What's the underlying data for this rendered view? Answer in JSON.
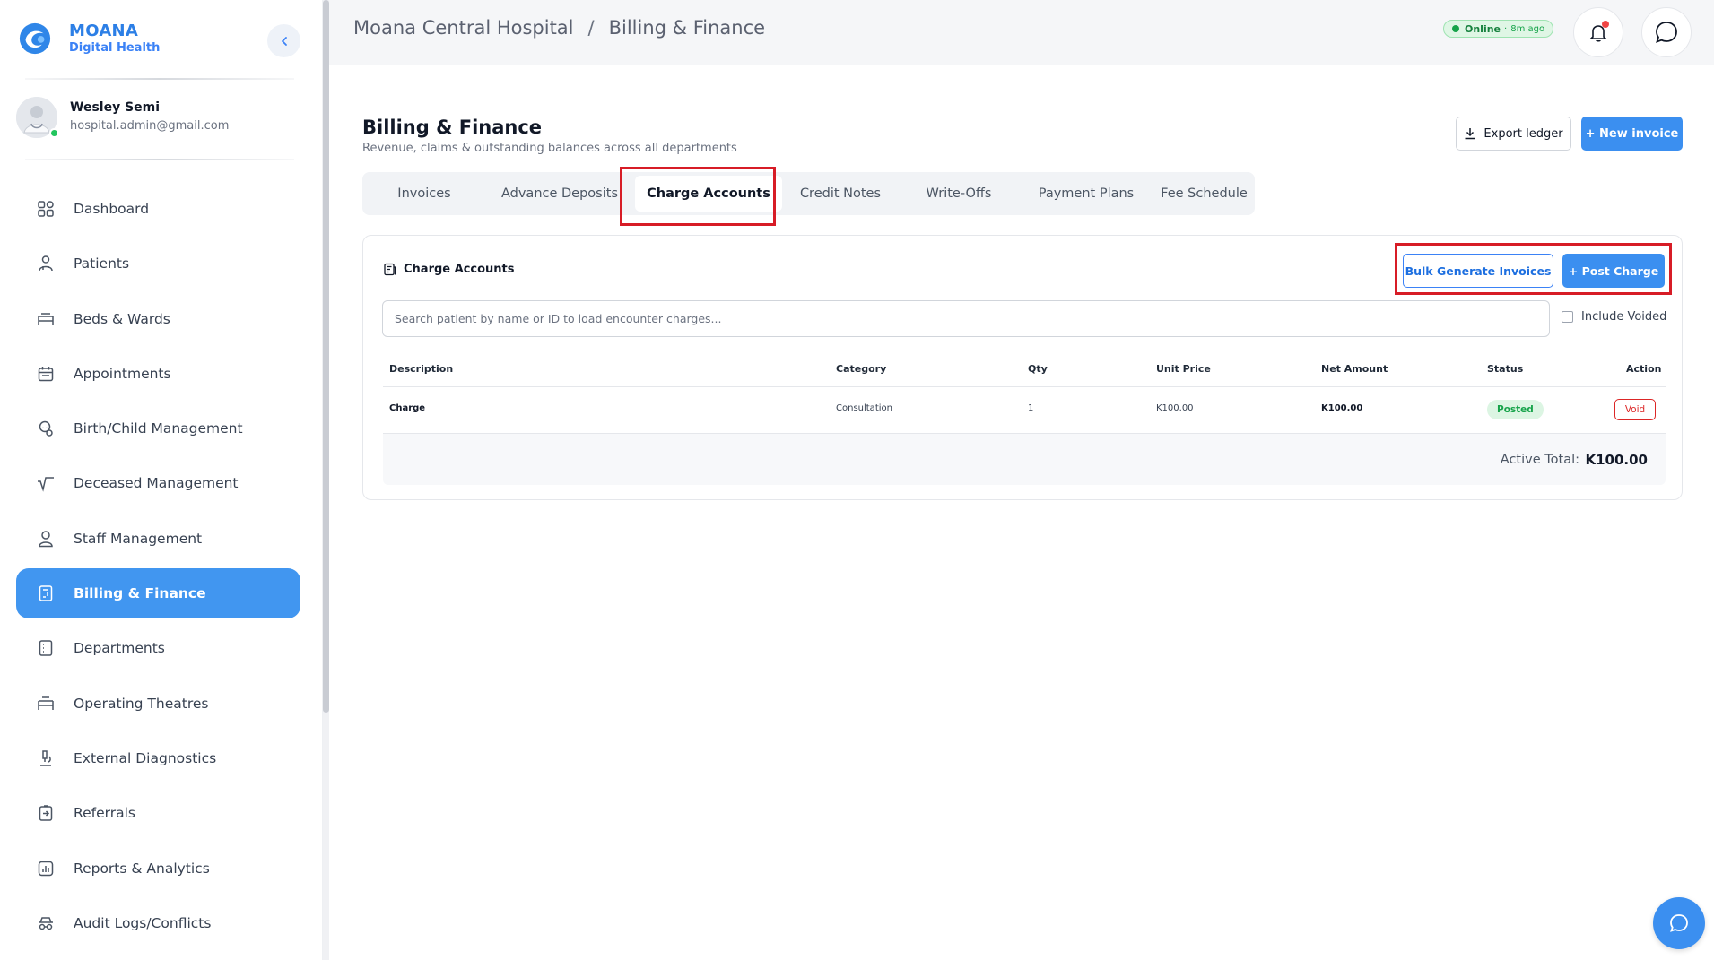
{
  "brand": {
    "name": "MOANA",
    "subtitle": "Digital Health"
  },
  "user": {
    "name": "Wesley Semi",
    "email": "hospital.admin@gmail.com"
  },
  "sidebar": {
    "items": [
      {
        "label": "Dashboard",
        "icon": "grid-icon"
      },
      {
        "label": "Patients",
        "icon": "patient-icon"
      },
      {
        "label": "Beds & Wards",
        "icon": "bed-icon"
      },
      {
        "label": "Appointments",
        "icon": "calendar-icon"
      },
      {
        "label": "Birth/Child Management",
        "icon": "baby-icon"
      },
      {
        "label": "Deceased Management",
        "icon": "pulse-icon"
      },
      {
        "label": "Staff Management",
        "icon": "staff-icon"
      },
      {
        "label": "Billing & Finance",
        "icon": "invoice-icon",
        "active": true
      },
      {
        "label": "Departments",
        "icon": "building-icon"
      },
      {
        "label": "Operating Theatres",
        "icon": "theatre-icon"
      },
      {
        "label": "External Diagnostics",
        "icon": "microscope-icon"
      },
      {
        "label": "Referrals",
        "icon": "referral-icon"
      },
      {
        "label": "Reports & Analytics",
        "icon": "report-icon"
      },
      {
        "label": "Audit Logs/Conflicts",
        "icon": "audit-icon"
      }
    ]
  },
  "header": {
    "breadcrumb": [
      "Moana Central Hospital",
      "Billing & Finance"
    ],
    "separator": "/",
    "status": {
      "label": "Online",
      "dot": "·",
      "ago": "8m ago"
    }
  },
  "page": {
    "title": "Billing & Finance",
    "subtitle": "Revenue, claims & outstanding balances across all departments",
    "export_label": "Export ledger",
    "new_invoice_label": "+ New invoice"
  },
  "tabs": [
    {
      "label": "Invoices"
    },
    {
      "label": "Advance Deposits"
    },
    {
      "label": "Charge Accounts",
      "active": true
    },
    {
      "label": "Credit Notes"
    },
    {
      "label": "Write-Offs"
    },
    {
      "label": "Payment Plans"
    },
    {
      "label": "Fee Schedule"
    }
  ],
  "charge_accounts": {
    "title": "Charge Accounts",
    "bulk_label": "Bulk Generate Invoices",
    "post_label": "+ Post Charge",
    "search_placeholder": "Search patient by name or ID to load encounter charges...",
    "include_voided_label": "Include Voided",
    "columns": [
      "Description",
      "Category",
      "Qty",
      "Unit Price",
      "Net Amount",
      "Status",
      "Action"
    ],
    "rows": [
      {
        "description": "Charge",
        "category": "Consultation",
        "qty": "1",
        "unit_price": "K100.00",
        "net_amount": "K100.00",
        "status": "Posted",
        "action": "Void"
      }
    ],
    "total_label": "Active Total:",
    "total_value": "K100.00"
  },
  "colors": {
    "accent": "#3b8ff0",
    "highlight": "#d71c26",
    "success": "#16a34a",
    "danger": "#dc2626"
  }
}
